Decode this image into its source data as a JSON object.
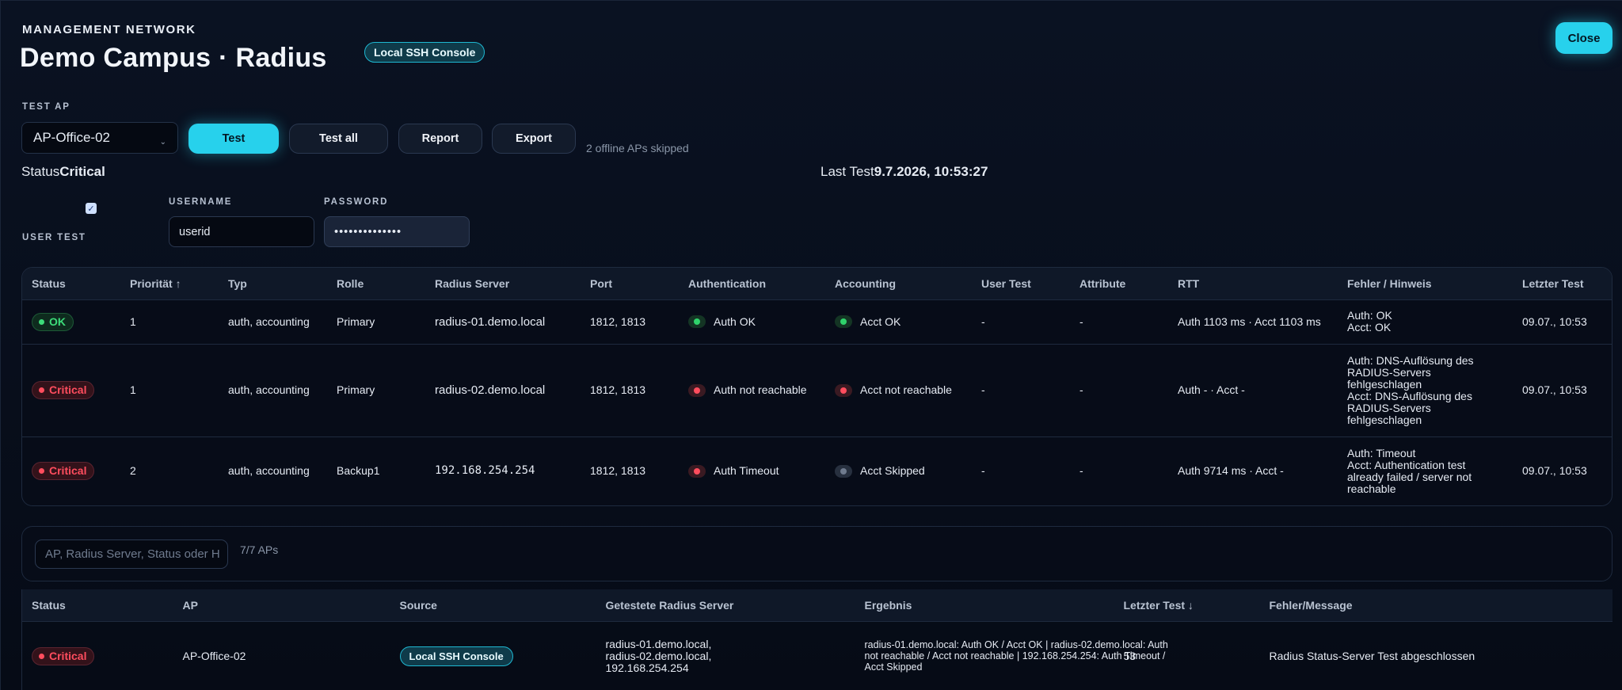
{
  "header": {
    "eyebrow": "MANAGEMENT NETWORK",
    "title": "Demo Campus · Radius",
    "source_badge": "Local SSH Console",
    "close_label": "Close"
  },
  "test_ap": {
    "label": "TEST AP",
    "selected": "AP-Office-02",
    "buttons": {
      "test": "Test",
      "test_all": "Test all",
      "report": "Report",
      "export": "Export"
    },
    "skipped_note": "2 offline APs skipped"
  },
  "status": {
    "label": "Status",
    "value": "Critical",
    "last_test_label": "Last Test",
    "last_test_value": "9.7.2026, 10:53:27"
  },
  "user_test": {
    "label": "USER TEST",
    "checked": true,
    "username_label": "USERNAME",
    "username_value": "userid",
    "password_label": "PASSWORD",
    "password_value": "••••••••••••••"
  },
  "servers_table": {
    "headers": [
      "Status",
      "Priorität ↑",
      "Typ",
      "Rolle",
      "Radius Server",
      "Port",
      "Authentication",
      "Accounting",
      "User Test",
      "Attribute",
      "RTT",
      "Fehler / Hinweis",
      "Letzter Test"
    ],
    "rows": [
      {
        "status": "OK",
        "priority": "1",
        "type": "auth, accounting",
        "role": "Primary",
        "server": "radius-01.demo.local",
        "port": "1812, 1813",
        "auth": "Auth OK",
        "acct": "Acct OK",
        "user_test": "-",
        "attribute": "-",
        "rtt": "Auth 1103 ms · Acct 1103 ms",
        "error": [
          "Auth: OK",
          "Acct: OK"
        ],
        "last_test": "09.07., 10:53"
      },
      {
        "status": "Critical",
        "priority": "1",
        "type": "auth, accounting",
        "role": "Primary",
        "server": "radius-02.demo.local",
        "port": "1812, 1813",
        "auth": "Auth not reachable",
        "acct": "Acct not reachable",
        "user_test": "-",
        "attribute": "-",
        "rtt": "Auth - · Acct -",
        "error": [
          "Auth: DNS-Auflösung des",
          "RADIUS-Servers",
          "fehlgeschlagen",
          "Acct: DNS-Auflösung des",
          "RADIUS-Servers",
          "fehlgeschlagen"
        ],
        "last_test": "09.07., 10:53"
      },
      {
        "status": "Critical",
        "priority": "2",
        "type": "auth, accounting",
        "role": "Backup1",
        "server": "192.168.254.254",
        "port": "1812, 1813",
        "auth": "Auth Timeout",
        "acct": "Acct Skipped",
        "user_test": "-",
        "attribute": "-",
        "rtt": "Auth 9714 ms · Acct -",
        "error": [
          "Auth: Timeout",
          "Acct: Authentication test",
          "already failed / server not",
          "reachable"
        ],
        "last_test": "09.07., 10:53"
      }
    ]
  },
  "filter": {
    "placeholder": "AP, Radius Server, Status oder H",
    "count": "7/7 APs"
  },
  "ap_table": {
    "headers": [
      "Status",
      "AP",
      "Source",
      "Getestete Radius Server",
      "Ergebnis",
      "Letzter Test ↓",
      "Fehler/Message"
    ],
    "rows": [
      {
        "status": "Critical",
        "ap": "AP-Office-02",
        "source": "Local SSH Console",
        "servers": [
          "radius-01.demo.local,",
          "radius-02.demo.local,",
          "192.168.254.254"
        ],
        "result_top": "radius-01.demo.local: Auth OK / Acct OK | radius-02.demo.local: Auth",
        "result": [
          "radius-01.demo.local: Auth OK / Acct OK | radius-02.demo.local: Auth",
          "not reachable / Acct not reachable | 192.168.254.254: Auth Timeout /",
          "Acct Skipped"
        ],
        "last_test": "53",
        "message": "Radius Status-Server Test abgeschlossen"
      }
    ]
  },
  "colors": {
    "accent": "#27d1ec",
    "ok": "#3ddc7a",
    "critical": "#ff4d5e",
    "background": "#070c18"
  }
}
